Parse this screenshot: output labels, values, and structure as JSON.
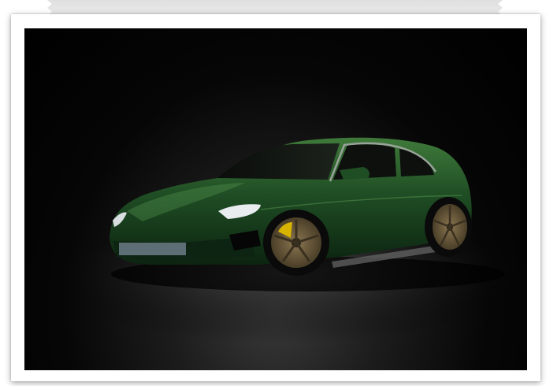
{
  "image": {
    "subject": "car-photo",
    "colors": {
      "background": "#000000",
      "body": "#1f4d24",
      "body_highlight": "#3f7a3a",
      "wheel": "#6b5a3a",
      "caliper": "#d8b400"
    }
  }
}
